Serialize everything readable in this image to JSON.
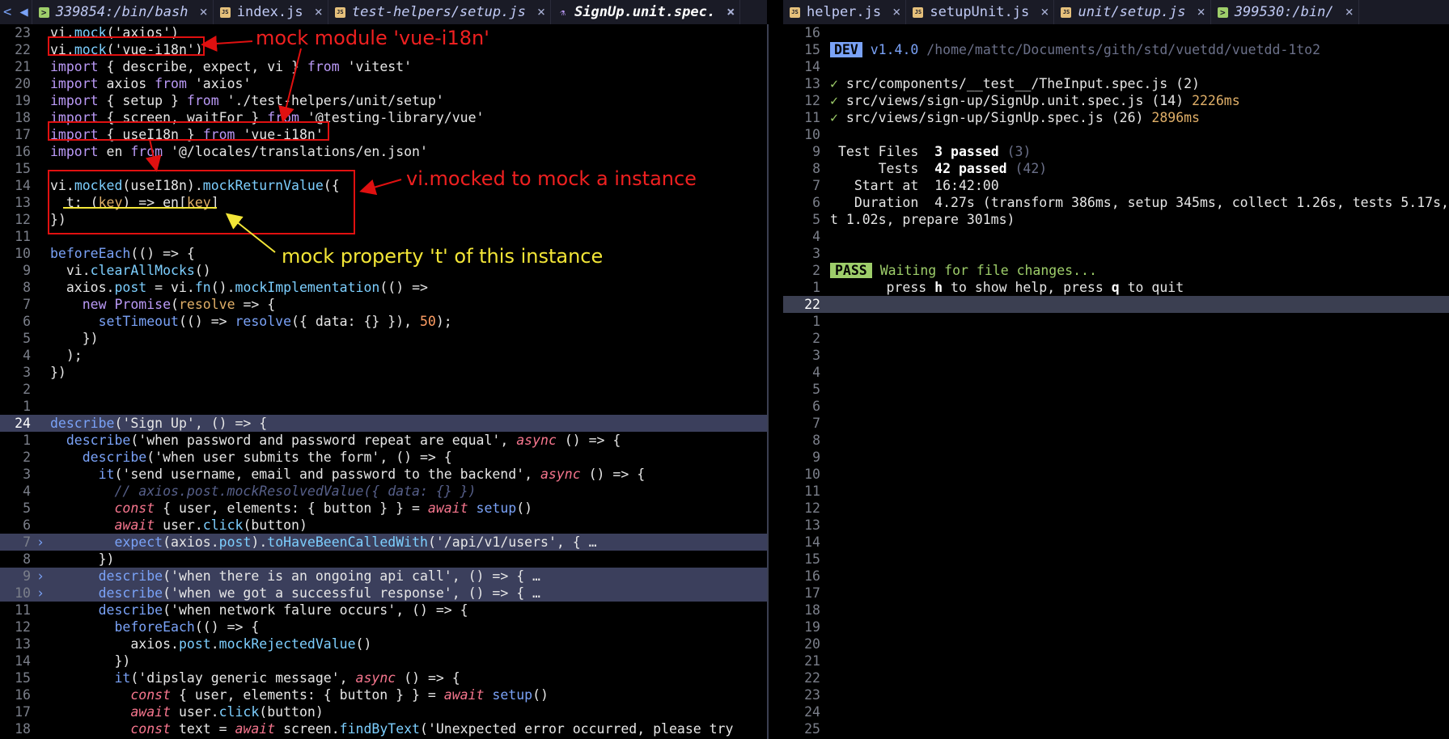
{
  "tabs_left": [
    {
      "label": "339854:/bin/bash",
      "icon": "terminal-icon",
      "italic": true
    },
    {
      "label": "index.js",
      "icon": "javascript-file-icon",
      "italic": false
    },
    {
      "label": "test-helpers/setup.js",
      "icon": "javascript-file-icon",
      "italic": true
    },
    {
      "label": "SignUp.unit.spec.",
      "icon": "flask-icon",
      "italic": true,
      "active": true
    }
  ],
  "tabs_right": [
    {
      "label": "helper.js",
      "icon": "javascript-file-icon",
      "italic": false
    },
    {
      "label": "setupUnit.js",
      "icon": "javascript-file-icon",
      "italic": false
    },
    {
      "label": "unit/setup.js",
      "icon": "javascript-file-icon",
      "italic": true
    },
    {
      "label": "399530:/bin/",
      "icon": "terminal-icon",
      "italic": true
    }
  ],
  "annotations": {
    "mock_module": "mock module 'vue-i18n'",
    "vi_mocked": "vi.mocked to mock a instance",
    "mock_property": "mock property 't' of this instance"
  },
  "annotation_colors": {
    "red": "#ef2020",
    "yellow": "#f3e637"
  },
  "editor": {
    "line_numbers": [
      "23",
      "22",
      "21",
      "20",
      "19",
      "18",
      "17",
      "16",
      "15",
      "14",
      "13",
      "12",
      "11",
      "10",
      "9",
      "8",
      "7",
      "6",
      "5",
      "4",
      "3",
      "2",
      "1",
      "24",
      "1",
      "2",
      "3",
      "4",
      "5",
      "6",
      "7",
      "8",
      "9",
      "10",
      "11",
      "12",
      "13",
      "14",
      "15",
      "16",
      "17",
      "18"
    ],
    "lines": [
      "vi.mock('axios')",
      "vi.mock('vue-i18n')",
      "import { describe, expect, vi } from 'vitest'",
      "import axios from 'axios'",
      "import { setup } from './test-helpers/unit/setup'",
      "import { screen, waitFor } from '@testing-library/vue'",
      "import { useI18n } from 'vue-i18n'",
      "import en from '@/locales/translations/en.json'",
      "",
      "vi.mocked(useI18n).mockReturnValue({",
      "  t: (key) => en[key]",
      "})",
      "",
      "beforeEach(() => {",
      "  vi.clearAllMocks()",
      "  axios.post = vi.fn().mockImplementation(() =>",
      "    new Promise(resolve => {",
      "      setTimeout(() => resolve({ data: {} }), 50);",
      "    })",
      "  );",
      "})",
      "",
      "",
      "describe('Sign Up', () => {",
      "  describe('when password and password repeat are equal', async () => {",
      "    describe('when user submits the form', () => {",
      "      it('send username, email and password to the backend', async () => {",
      "        // axios.post.mockResolvedValue({ data: {} })",
      "        const { user, elements: { button } } = await setup()",
      "        await user.click(button)",
      "        expect(axios.post).toHaveBeenCalledWith('/api/v1/users', { …",
      "      })",
      "      describe('when there is an ongoing api call', () => { …",
      "      describe('when we got a successful response', () => { …",
      "      describe('when network falure occurs', () => {",
      "        beforeEach(() => {",
      "          axios.post.mockRejectedValue()",
      "        })",
      "        it('dipslay generic message', async () => {",
      "          const { user, elements: { button } } = await setup()",
      "          await user.click(button)",
      "          const text = await screen.findByText('Unexpected error occurred, please try"
    ]
  },
  "terminal": {
    "line_numbers": [
      "16",
      "15",
      "14",
      "13",
      "12",
      "11",
      "10",
      "9",
      "8",
      "7",
      "6",
      "5",
      "4",
      "3",
      "2",
      "1",
      "22",
      "1",
      "2",
      "3",
      "4",
      "5",
      "6",
      "7",
      "8",
      "9",
      "10",
      "11",
      "12",
      "13",
      "14",
      "15",
      "16",
      "17",
      "18",
      "19",
      "20",
      "21",
      "22",
      "23",
      "24",
      "25"
    ],
    "dev_badge": "DEV",
    "version": "v1.4.0",
    "path": "/home/mattc/Documents/gith/std/vuetdd/vuetdd-1to2",
    "results": [
      {
        "mark": "✓",
        "file": "src/components/__test__/TheInput.spec.js",
        "count": "(2)",
        "time": ""
      },
      {
        "mark": "✓",
        "file": "src/views/sign-up/SignUp.unit.spec.js",
        "count": "(14)",
        "time": "2226ms"
      },
      {
        "mark": "✓",
        "file": "src/views/sign-up/SignUp.spec.js",
        "count": "(26)",
        "time": "2896ms"
      }
    ],
    "test_files_label": "Test Files",
    "test_files_value": "3 passed",
    "test_files_total": "(3)",
    "tests_label": "Tests",
    "tests_value": "42 passed",
    "tests_total": "(42)",
    "start_label": "Start at",
    "start_value": "16:42:00",
    "duration_label": "Duration",
    "duration_value": "4.27s (transform 386ms, setup 345ms, collect 1.26s, tests 5.17s,",
    "duration_wrap": "t 1.02s, prepare 301ms)",
    "pass_badge": "PASS",
    "waiting": "Waiting for file changes...",
    "help_press1": "press ",
    "help_h": "h",
    "help_mid": " to show help, press ",
    "help_q": "q",
    "help_end": " to quit"
  }
}
